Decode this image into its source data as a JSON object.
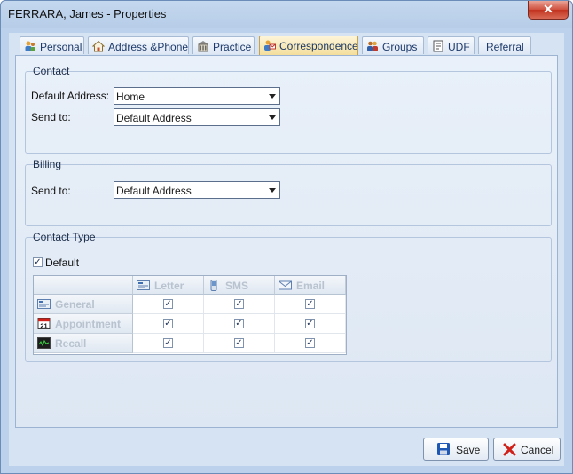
{
  "window": {
    "title": "FERRARA, James - Properties",
    "close_label": "✕"
  },
  "tabs": [
    {
      "label": "Personal",
      "icon": "people-icon"
    },
    {
      "label": "Address &Phone",
      "icon": "house-icon"
    },
    {
      "label": "Practice",
      "icon": "building-icon"
    },
    {
      "label": "Correspondence",
      "icon": "correspondence-icon",
      "active": true
    },
    {
      "label": "Groups",
      "icon": "group-icon"
    },
    {
      "label": "UDF",
      "icon": "form-icon"
    },
    {
      "label": "Referral",
      "icon": ""
    }
  ],
  "contact": {
    "title": "Contact",
    "default_address_label": "Default Address:",
    "default_address_value": "Home",
    "send_to_label": "Send to:",
    "send_to_value": "Default Address"
  },
  "billing": {
    "title": "Billing",
    "send_to_label": "Send to:",
    "send_to_value": "Default Address"
  },
  "contact_type": {
    "title": "Contact Type",
    "default_label": "Default",
    "default_checked": true,
    "columns": [
      "Letter",
      "SMS",
      "Email"
    ],
    "rows": [
      {
        "label": "General",
        "values": [
          true,
          true,
          true
        ]
      },
      {
        "label": "Appointment",
        "values": [
          true,
          true,
          true
        ]
      },
      {
        "label": "Recall",
        "values": [
          true,
          true,
          true
        ]
      }
    ],
    "appointment_icon_text": "21"
  },
  "buttons": {
    "save": "Save",
    "cancel": "Cancel"
  },
  "colors": {
    "accent": "#f3de9c",
    "cancel_x": "#d0201a",
    "save_disk": "#1f57b5"
  }
}
